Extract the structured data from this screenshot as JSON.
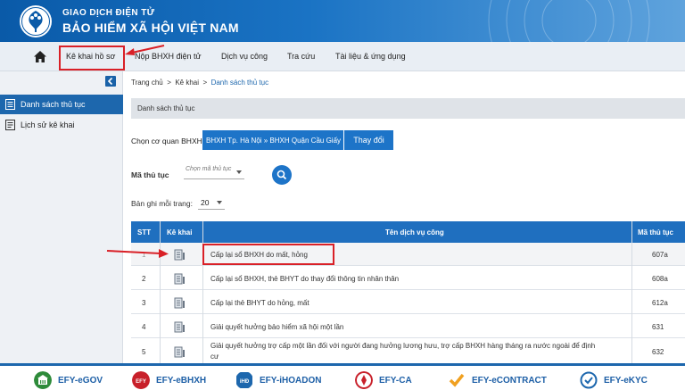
{
  "header": {
    "brand_top": "GIAO DỊCH ĐIỆN TỬ",
    "brand_bottom": "BẢO HIỂM XÃ HỘI VIỆT NAM"
  },
  "nav": {
    "home_icon": "home-icon",
    "items": [
      "Kê khai hồ sơ",
      "Nộp BHXH điện tử",
      "Dịch vụ công",
      "Tra cứu",
      "Tài liệu & ứng dụng"
    ]
  },
  "sidebar": {
    "items": [
      {
        "label": "Danh sách thủ tục",
        "icon": "list-icon",
        "active": true
      },
      {
        "label": "Lịch sử kê khai",
        "icon": "history-icon",
        "active": false
      }
    ]
  },
  "breadcrumb": {
    "home": "Trang chủ",
    "sep": ">",
    "section": "Kê khai",
    "current": "Danh sách thủ tục"
  },
  "panel": {
    "title": "Danh sách thủ tục"
  },
  "agency": {
    "label": "Chọn cơ quan BHXH:",
    "value": "BHXH Tp. Hà Nội » BHXH Quận Cầu Giấy",
    "change_button": "Thay đổi"
  },
  "filter": {
    "code_label": "Mã thủ tục",
    "code_placeholder": "Chọn mã thủ tục",
    "perpage_label": "Bản ghi mỗi trang:",
    "perpage_value": "20"
  },
  "table": {
    "headers": [
      "STT",
      "Kê khai",
      "Tên dịch vụ công",
      "Mã thủ tục"
    ],
    "rows": [
      {
        "stt": "1",
        "name": "Cấp lại sổ BHXH do mất, hỏng",
        "code": "607a"
      },
      {
        "stt": "2",
        "name": "Cấp lại sổ BHXH, thẻ BHYT do thay đổi thông tin nhân thân",
        "code": "608a"
      },
      {
        "stt": "3",
        "name": "Cấp lại thẻ BHYT do hỏng, mất",
        "code": "612a"
      },
      {
        "stt": "4",
        "name": "Giải quyết hưởng bảo hiểm xã hội một lần",
        "code": "631"
      },
      {
        "stt": "5",
        "name": "Giải quyết hưởng trợ cấp một lần đối với người đang hưởng lương hưu, trợ cấp BHXH hàng tháng ra nước ngoài để định",
        "name2": "cư",
        "code": "632"
      }
    ]
  },
  "footer": {
    "products": [
      {
        "label": "EFY-eGOV",
        "color": "#2e8b3a"
      },
      {
        "label": "EFY-eBHXH",
        "color": "#c8202a"
      },
      {
        "label": "EFY-iHOADON",
        "color": "#1d67ad"
      },
      {
        "label": "EFY-CA",
        "color": "#c8202a"
      },
      {
        "label": "EFY-eCONTRACT",
        "color": "#f0a020"
      },
      {
        "label": "EFY-eKYC",
        "color": "#1d67ad"
      }
    ]
  },
  "colors": {
    "header_blue": "#0a5aa8",
    "active_blue": "#1d67ad",
    "highlight_red": "#d92027"
  }
}
